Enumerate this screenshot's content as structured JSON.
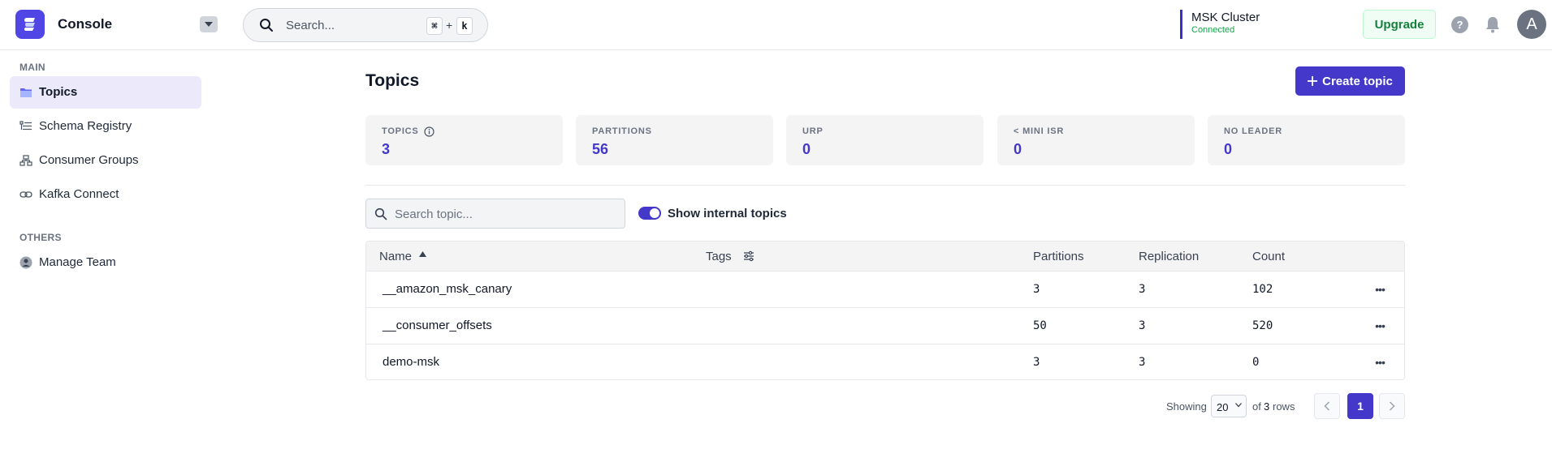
{
  "header": {
    "app_title": "Console",
    "search_placeholder": "Search...",
    "shortcut_key1": "⌘",
    "shortcut_plus": "+",
    "shortcut_key2": "k",
    "cluster_name": "MSK Cluster",
    "cluster_status": "Connected",
    "upgrade_label": "Upgrade",
    "help_label": "?",
    "avatar_initial": "A"
  },
  "sidebar": {
    "main_label": "MAIN",
    "others_label": "OTHERS",
    "items": [
      {
        "label": "Topics",
        "icon": "folder-icon",
        "active": true
      },
      {
        "label": "Schema Registry",
        "icon": "schema-icon",
        "active": false
      },
      {
        "label": "Consumer Groups",
        "icon": "consumer-groups-icon",
        "active": false
      },
      {
        "label": "Kafka Connect",
        "icon": "connect-icon",
        "active": false
      }
    ],
    "others_items": [
      {
        "label": "Manage Team",
        "icon": "team-icon"
      }
    ]
  },
  "main": {
    "title": "Topics",
    "create_label": "Create topic",
    "stats": [
      {
        "label": "TOPICS",
        "value": "3"
      },
      {
        "label": "PARTITIONS",
        "value": "56"
      },
      {
        "label": "URP",
        "value": "0"
      },
      {
        "label": "< MINI ISR",
        "value": "0"
      },
      {
        "label": "NO LEADER",
        "value": "0"
      }
    ],
    "search_placeholder": "Search topic...",
    "toggle_label": "Show internal topics",
    "toggle_on": true
  },
  "table": {
    "columns": [
      "Name",
      "Tags",
      "Partitions",
      "Replication",
      "Count"
    ],
    "rows": [
      {
        "name": "__amazon_msk_canary",
        "partitions": "3",
        "replication": "3",
        "count": "102"
      },
      {
        "name": "__consumer_offsets",
        "partitions": "50",
        "replication": "3",
        "count": "520"
      },
      {
        "name": "demo-msk",
        "partitions": "3",
        "replication": "3",
        "count": "0"
      }
    ]
  },
  "pagination": {
    "showing_label": "Showing",
    "page_size": "20",
    "of_label": "of",
    "total_rows": "3",
    "rows_label": "rows",
    "current_page": "1"
  },
  "colors": {
    "accent": "#4338ca",
    "connected": "#16a34a",
    "upgrade": "#15803d"
  }
}
